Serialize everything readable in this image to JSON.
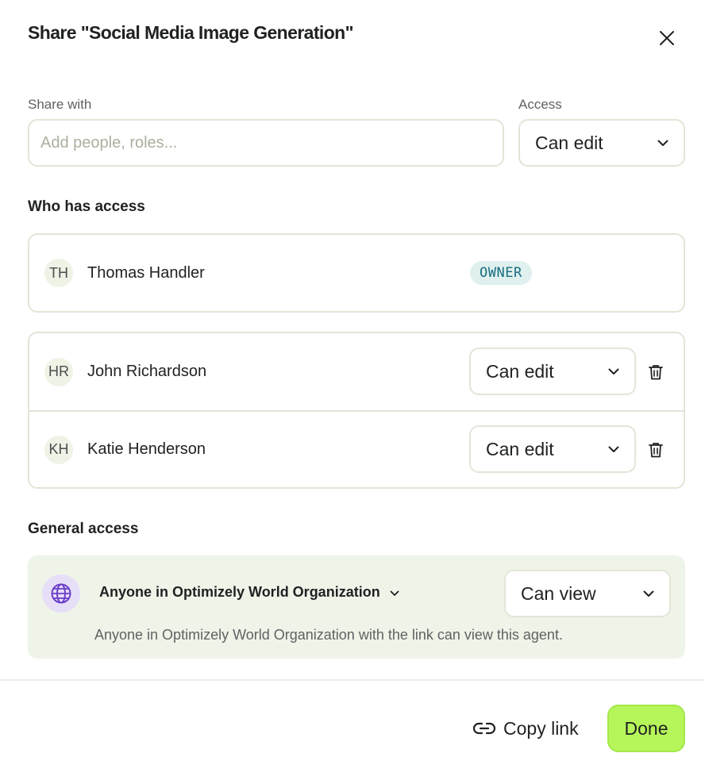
{
  "dialog": {
    "title": "Share \"Social Media Image Generation\"",
    "close_icon": "close-icon"
  },
  "share": {
    "label": "Share with",
    "placeholder": "Add people, roles...",
    "value": ""
  },
  "access": {
    "label": "Access",
    "value": "Can edit"
  },
  "who_has_access": {
    "heading": "Who has access",
    "owner": {
      "initials": "TH",
      "name": "Thomas Handler",
      "badge": "OWNER"
    },
    "members": [
      {
        "initials": "HR",
        "name": "John Richardson",
        "permission": "Can edit"
      },
      {
        "initials": "KH",
        "name": "Katie Henderson",
        "permission": "Can edit"
      }
    ]
  },
  "general_access": {
    "heading": "General access",
    "icon": "globe-icon",
    "scope": "Anyone in Optimizely World Organization",
    "permission": "Can view",
    "description": "Anyone in Optimizely World Organization with the link can view this agent."
  },
  "footer": {
    "copy_link_label": "Copy link",
    "done_label": "Done"
  },
  "colors": {
    "accent": "#b6f65a",
    "border": "#e1e6d7",
    "badge_bg": "#dff0ee",
    "badge_text": "#196d82",
    "globe": "#6a3fc8"
  }
}
